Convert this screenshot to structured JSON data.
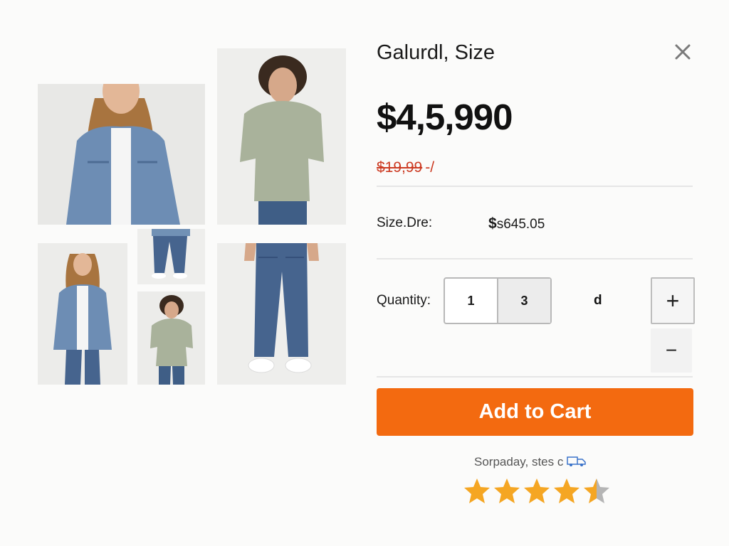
{
  "product": {
    "title": "Galurdl, Size",
    "price": "$4,5,990",
    "old_price": "$19,99",
    "old_price_suffix": "-/"
  },
  "size": {
    "label": "Size.Dre:",
    "price_symbol": "$",
    "price_value": "s645.05"
  },
  "quantity": {
    "label": "Quantity:",
    "values": [
      "1",
      "3"
    ],
    "extra": "d",
    "increment_symbol": "+",
    "decrement_symbol": "−"
  },
  "cart": {
    "button_label": "Add to Cart"
  },
  "delivery": {
    "text": "Sorpaday, stes c"
  },
  "rating": {
    "value": 4.5,
    "max": 5
  },
  "icons": {
    "close": "close-icon",
    "delivery": "truck-icon",
    "star": "star-icon"
  },
  "colors": {
    "accent": "#f36a10",
    "old_price": "#cc3a22",
    "star": "#f5a623",
    "star_empty": "#b5b5b5"
  },
  "gallery": [
    {
      "description": "woman-denim-jacket-front"
    },
    {
      "description": "man-green-tshirt-front"
    },
    {
      "description": "woman-denim-jacket-full"
    },
    {
      "description": "jeans-detail"
    },
    {
      "description": "man-green-tshirt-full"
    },
    {
      "description": "man-jeans-legs"
    }
  ]
}
